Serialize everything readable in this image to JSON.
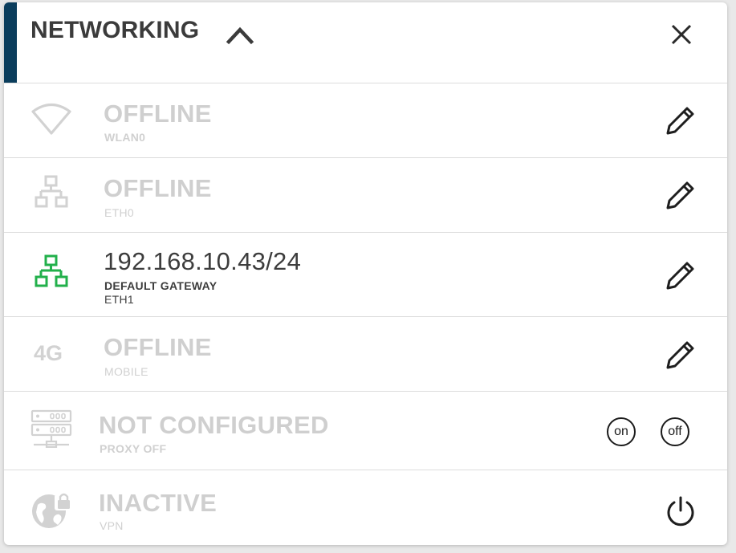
{
  "header": {
    "title": "NETWORKING"
  },
  "connections": [
    {
      "status": "OFFLINE",
      "interface": "WLAN0"
    },
    {
      "status": "OFFLINE",
      "interface": "ETH0"
    },
    {
      "status": "192.168.10.43/24",
      "detail": "DEFAULT GATEWAY",
      "interface": "ETH1"
    },
    {
      "status": "OFFLINE",
      "interface": "MOBILE",
      "badge": "4G"
    },
    {
      "status": "NOT CONFIGURED",
      "interface": "PROXY OFF",
      "toggle_on": "on",
      "toggle_off": "off"
    },
    {
      "status": "INACTIVE",
      "interface": "VPN"
    }
  ],
  "colors": {
    "accent": "#0b3d5c",
    "active_icon": "#22b04b",
    "inactive": "#cfcfcf",
    "text": "#3d3d3d"
  },
  "icons": {
    "collapse": "chevron-up-icon",
    "close": "close-icon",
    "edit": "pencil-icon",
    "wifi": "wifi-icon",
    "ethernet": "network-icon",
    "mobile": "4g-icon",
    "proxy": "server-icon",
    "vpn": "globe-lock-icon",
    "power": "power-icon"
  }
}
